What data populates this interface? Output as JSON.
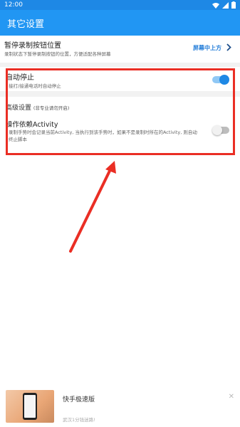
{
  "status_bar": {
    "time": "12:00",
    "icons": [
      "wifi-icon",
      "signal-icon",
      "battery-icon"
    ]
  },
  "app_bar": {
    "title": "其它设置"
  },
  "settings": {
    "pause_button_position": {
      "title": "暂停录制按钮位置",
      "description": "录制状态下暂停录制按钮的位置，方便适配各种屏幕",
      "value": "屏幕中上方",
      "icon": "chevron-right-icon"
    },
    "auto_stop": {
      "title": "自动停止",
      "description": "接打/接通电话时自动停止",
      "enabled": true
    },
    "advanced": {
      "title": "高级设置",
      "note": "(非专业请勿开启)"
    },
    "activity_dependency": {
      "title": "操作依赖Activity",
      "description": "录制手势时会记录当前Activity, 当执行到该手势时，如果不是录制时所在的Activity, 则自动终止脚本",
      "enabled": false
    }
  },
  "ad": {
    "title": "快手极速版",
    "subtitle": "武汉1分钱迷路!",
    "close_icon": "close-icon"
  },
  "colors": {
    "status_bar": "#1e88e5",
    "app_bar": "#2196f3",
    "accent": "#1e7ad8",
    "highlight": "#ea2e24"
  }
}
